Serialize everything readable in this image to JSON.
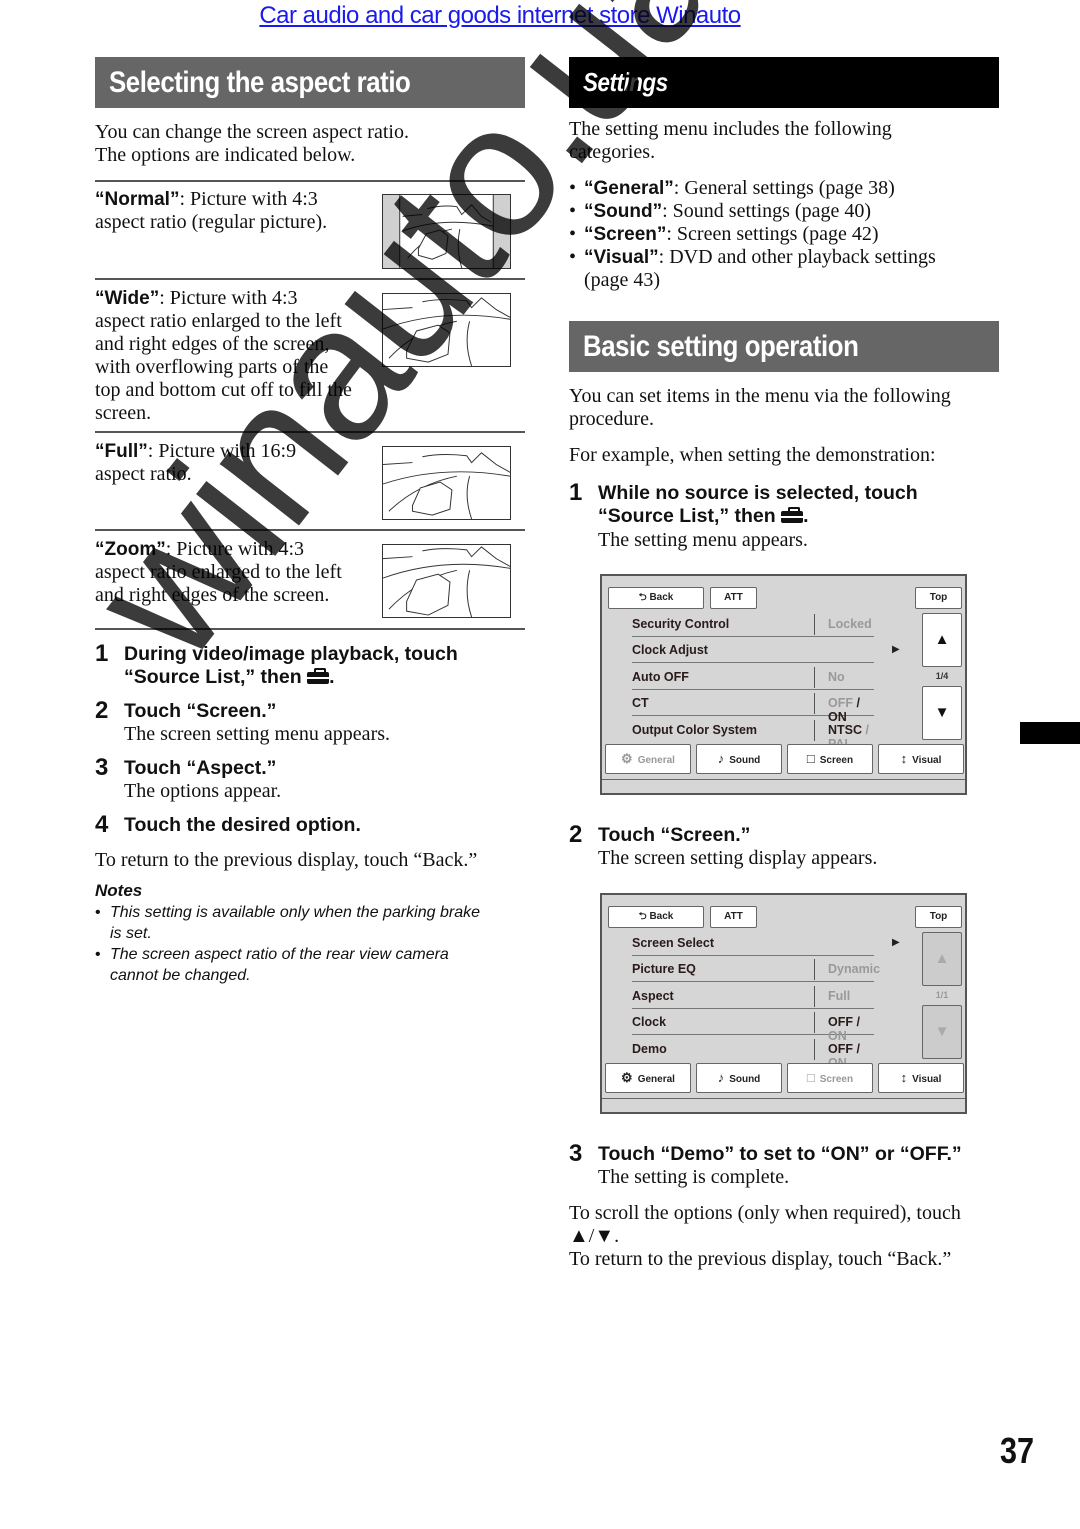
{
  "top_link": "Car audio and car goods internet store Winauto",
  "left": {
    "header": "Selecting the aspect ratio",
    "intro": [
      "You can change the screen aspect ratio.",
      "The options are indicated below."
    ],
    "options": [
      {
        "name": "“Normal”",
        "desc_lines": [
          ": Picture with 4:3",
          "aspect ratio (regular picture)."
        ],
        "image": "normal-aspect-illustration"
      },
      {
        "name": "“Wide”",
        "desc_lines": [
          ": Picture with 4:3",
          "aspect ratio enlarged to the left",
          "and right edges of the screen,",
          "with overflowing parts of the",
          "top and bottom cut off to fill the",
          "screen."
        ],
        "image": "wide-aspect-illustration"
      },
      {
        "name": "“Full”",
        "desc_lines": [
          ": Picture with 16:9",
          "aspect ratio."
        ],
        "image": "full-aspect-illustration"
      },
      {
        "name": "“Zoom”",
        "desc_lines": [
          ": Picture with 4:3",
          "aspect ratio enlarged to the left",
          "and right edges of the screen."
        ],
        "image": "zoom-aspect-illustration"
      }
    ],
    "steps": [
      {
        "num": "1",
        "title_lines": [
          "During video/image playback, touch",
          "“Source List,” then"
        ],
        "icon": "toolbox-icon",
        "sub": ""
      },
      {
        "num": "2",
        "title_lines": [
          "Touch “Screen.”"
        ],
        "sub": "The screen setting menu appears."
      },
      {
        "num": "3",
        "title_lines": [
          "Touch “Aspect.”"
        ],
        "sub": "The options appear."
      },
      {
        "num": "4",
        "title_lines": [
          "Touch the desired option."
        ],
        "sub": ""
      }
    ],
    "return_text": "To return to the previous display, touch “Back.”",
    "notes_title": "Notes",
    "notes": [
      [
        "This setting is available only when the parking brake",
        "is set."
      ],
      [
        "The screen aspect ratio of the rear view camera",
        "cannot be changed."
      ]
    ]
  },
  "right": {
    "settings_header": "Settings",
    "settings_intro": [
      "The setting menu includes the following",
      "categories."
    ],
    "categories": [
      {
        "name": "“General”",
        "desc": ": General settings (page 38)"
      },
      {
        "name": "“Sound”",
        "desc": ": Sound settings (page 40)"
      },
      {
        "name": "“Screen”",
        "desc": ": Screen settings (page 42)"
      },
      {
        "name": "“Visual”",
        "desc": ": DVD and other playback settings",
        "desc2": "(page 43)"
      }
    ],
    "basic_header": "Basic setting operation",
    "basic_intro": [
      "You can set items in the menu via the following",
      "procedure."
    ],
    "example": "For example, when setting the demonstration:",
    "steps": [
      {
        "num": "1",
        "title_lines": [
          "While no source is selected, touch",
          "“Source List,” then"
        ],
        "sub": "The setting menu appears."
      },
      {
        "num": "2",
        "title_lines": [
          "Touch “Screen.”"
        ],
        "sub": "The screen setting display appears."
      },
      {
        "num": "3",
        "title_lines": [
          "Touch “Demo” to set to “ON” or “OFF.”"
        ],
        "sub": "The setting is complete."
      }
    ],
    "scroll_text": [
      "To scroll the options (only when required), touch",
      "▲/▼."
    ],
    "return_text": "To return to the previous display, touch “Back.”"
  },
  "screen1": {
    "back": "Back",
    "att": "ATT",
    "top": "Top",
    "rows": [
      {
        "label": "Security Control",
        "value": "Locked",
        "value_dim": true
      },
      {
        "label": "Clock Adjust",
        "arrow": "▶"
      },
      {
        "label": "Auto OFF",
        "value": "No",
        "value_dim": true
      },
      {
        "label": "CT",
        "value_a": "OFF",
        "value_sep": " / ",
        "value_b": "ON",
        "a_dim": true,
        "b_dim": false
      },
      {
        "label": "Output Color System",
        "value_a": "NTSC",
        "value_sep": " / ",
        "value_b": "PAL",
        "a_dim": false,
        "b_dim": true
      }
    ],
    "up": "▲",
    "down": "▼",
    "page": "1/4",
    "tabs": [
      {
        "label": "General",
        "icon": "⚙",
        "disabled": true
      },
      {
        "label": "Sound",
        "icon": "♪",
        "disabled": false
      },
      {
        "label": "Screen",
        "icon": "□",
        "disabled": false
      },
      {
        "label": "Visual",
        "icon": "↕",
        "disabled": false
      }
    ]
  },
  "screen2": {
    "back": "Back",
    "att": "ATT",
    "top": "Top",
    "rows": [
      {
        "label": "Screen Select",
        "arrow": "▶"
      },
      {
        "label": "Picture EQ",
        "value": "Dynamic",
        "value_dim": true
      },
      {
        "label": "Aspect",
        "value": "Full",
        "value_dim": true
      },
      {
        "label": "Clock",
        "value_a": "OFF",
        "value_sep": " / ",
        "value_b": "ON",
        "a_dim": false,
        "b_dim": true
      },
      {
        "label": "Demo",
        "value_a": "OFF",
        "value_sep": " / ",
        "value_b": "ON",
        "a_dim": false,
        "b_dim": true
      }
    ],
    "up": "▲",
    "down": "▼",
    "page": "1/1",
    "tabs": [
      {
        "label": "General",
        "icon": "⚙",
        "disabled": false
      },
      {
        "label": "Sound",
        "icon": "♪",
        "disabled": false
      },
      {
        "label": "Screen",
        "icon": "□",
        "disabled": true
      },
      {
        "label": "Visual",
        "icon": "↕",
        "disabled": false
      }
    ]
  },
  "watermark": "winauto.ua",
  "page_number": "37"
}
